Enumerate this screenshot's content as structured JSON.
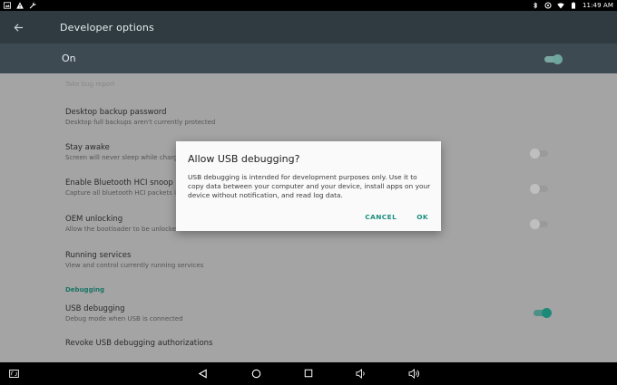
{
  "status_bar": {
    "left_icons": [
      "image-icon",
      "warning-icon",
      "wrench-icon"
    ],
    "right_icons": [
      "bluetooth-icon",
      "sync-icon",
      "wifi-icon",
      "battery-icon"
    ],
    "time": "11:49 AM"
  },
  "app_bar": {
    "title": "Developer options"
  },
  "master_switch": {
    "label": "On",
    "state": "on"
  },
  "settings": {
    "partial_item": "Take bug report",
    "items": [
      {
        "title": "Desktop backup password",
        "subtitle": "Desktop full backups aren't currently protected"
      },
      {
        "title": "Stay awake",
        "subtitle": "Screen will never sleep while charging",
        "toggle": "off"
      },
      {
        "title": "Enable Bluetooth HCI snoop log",
        "subtitle": "Capture all bluetooth HCI packets in a file",
        "toggle": "off"
      },
      {
        "title": "OEM unlocking",
        "subtitle": "Allow the bootloader to be unlocked",
        "toggle": "off"
      },
      {
        "title": "Running services",
        "subtitle": "View and control currently running services"
      }
    ],
    "category_debugging": "Debugging",
    "usb_debugging": {
      "title": "USB debugging",
      "subtitle": "Debug mode when USB is connected",
      "toggle": "on"
    },
    "revoke": {
      "title": "Revoke USB debugging authorizations"
    }
  },
  "dialog": {
    "title": "Allow USB debugging?",
    "body": "USB debugging is intended for development purposes only. Use it to copy data between your computer and your device, install apps on your device without notification, and read log data.",
    "cancel_label": "CANCEL",
    "ok_label": "OK"
  },
  "nav_bar": {
    "icons": [
      "screenshot-icon",
      "back-nav-icon",
      "home-icon",
      "recents-icon",
      "volume-down-icon",
      "volume-up-icon"
    ]
  },
  "colors": {
    "accent": "#1d8a78",
    "app_bar": "#2f3b41",
    "on_bar": "#3d4a51"
  }
}
